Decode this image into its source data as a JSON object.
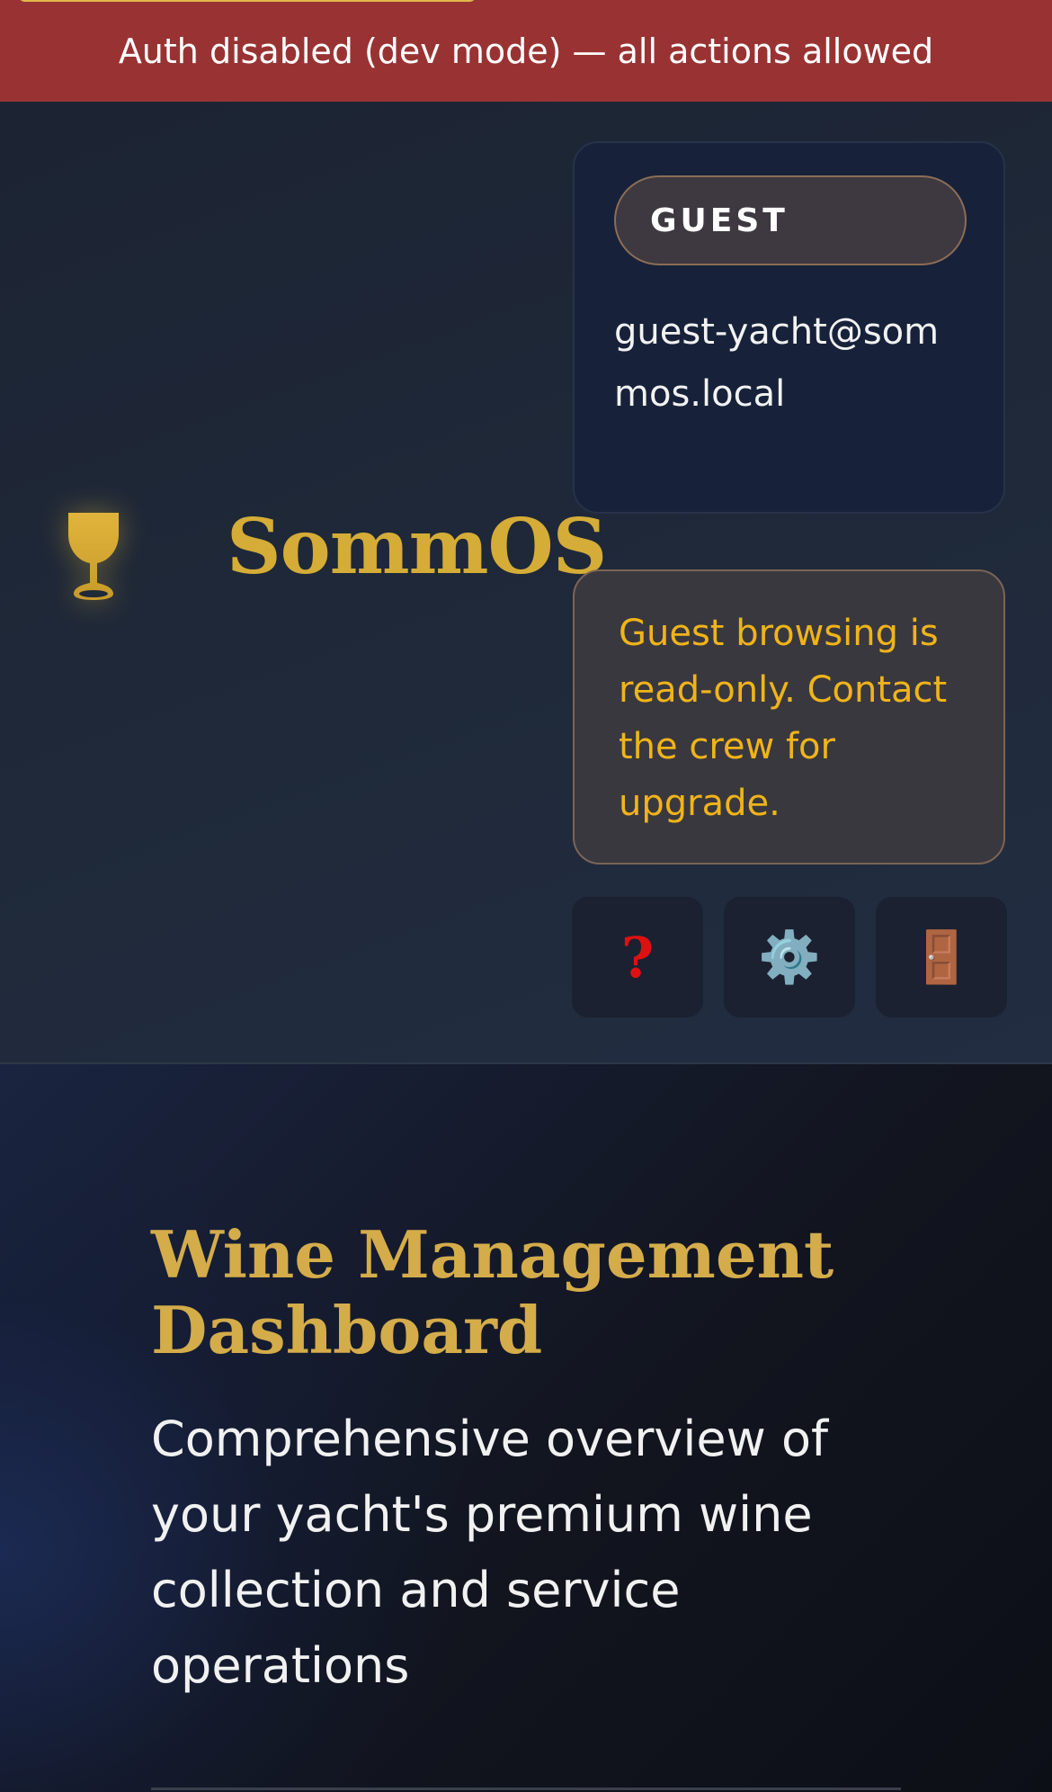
{
  "banner": {
    "text": "Auth disabled (dev mode) — all actions allowed",
    "color": "#993333"
  },
  "brand": {
    "icon": "wine-glass-icon",
    "name": "SommOS",
    "color": "#d4ac37"
  },
  "user": {
    "role": "GUEST",
    "email": "guest-yacht@sommos.local"
  },
  "notice": {
    "text": "Guest browsing is read-only. Contact the crew for upgrade.",
    "color": "#f0b419"
  },
  "actions": [
    {
      "name": "help",
      "icon": "question-mark-icon",
      "glyph": "?"
    },
    {
      "name": "settings",
      "icon": "gear-icon",
      "glyph": "⚙️"
    },
    {
      "name": "logout",
      "icon": "door-icon",
      "glyph": "🚪"
    }
  ],
  "dashboard": {
    "title": "Wine Management Dashboard",
    "subtitle": "Comprehensive overview of your yacht's premium wine collection and service operations"
  }
}
